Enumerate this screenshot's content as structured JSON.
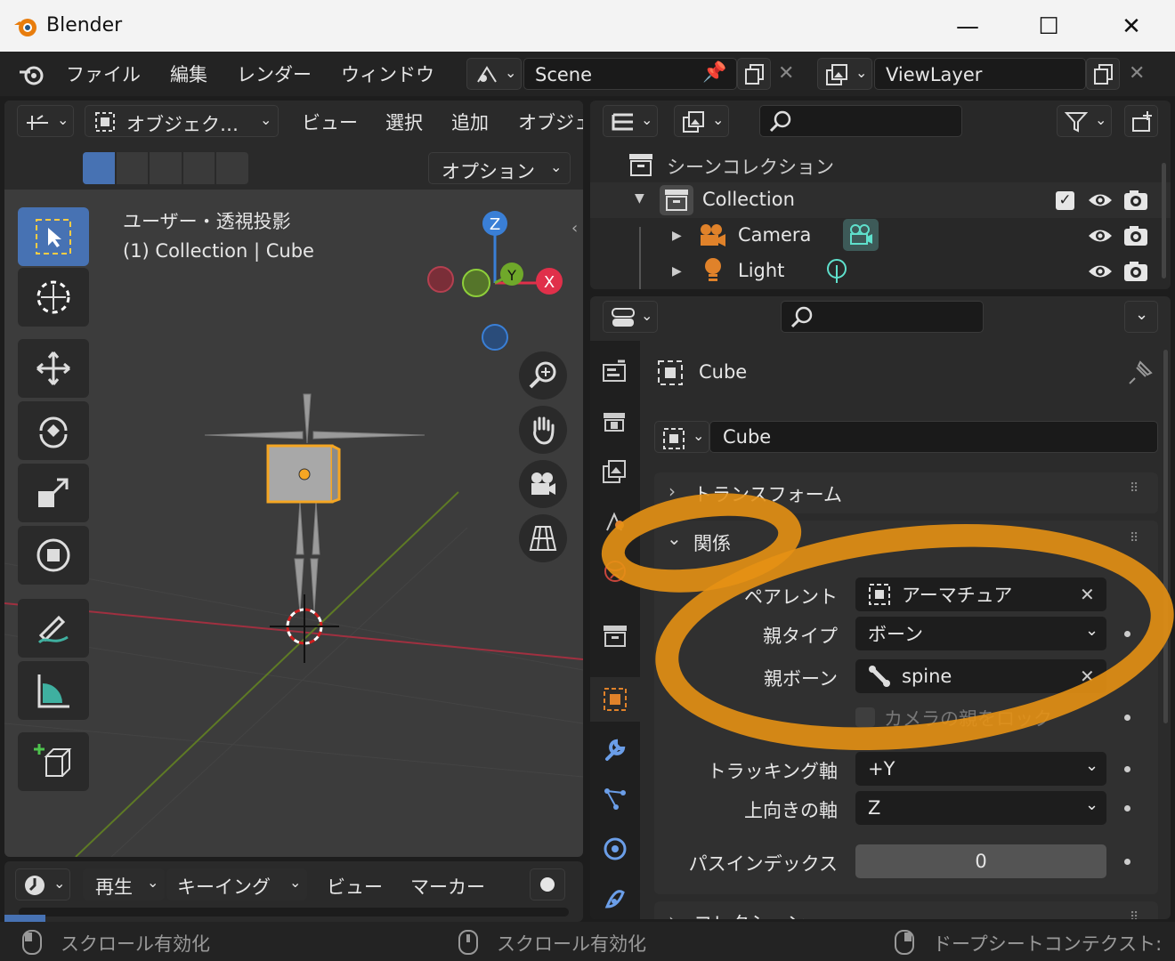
{
  "window": {
    "title": "Blender",
    "minimize": "—",
    "maximize": "☐",
    "close": "✕"
  },
  "menu": {
    "items": [
      "ファイル",
      "編集",
      "レンダー",
      "ウィンドウ"
    ],
    "scene": "Scene",
    "view_layer": "ViewLayer"
  },
  "viewport": {
    "mode_label": "オブジェク…",
    "header_menus": [
      "ビュー",
      "選択",
      "追加",
      "オブジェ"
    ],
    "options_label": "オプション",
    "view_name": "ユーザー・透視投影",
    "collection_info": "(1) Collection | Cube",
    "gizmo": {
      "z": "Z",
      "y": "Y",
      "x": "X"
    }
  },
  "timeline": {
    "menus": [
      "再生",
      "キーイング",
      "ビュー",
      "マーカー"
    ]
  },
  "outliner": {
    "scene_collection": "シーンコレクション",
    "rows": [
      {
        "name": "Collection"
      },
      {
        "name": "Camera"
      },
      {
        "name": "Light"
      }
    ]
  },
  "properties": {
    "object_name": "Cube",
    "object_field": "Cube",
    "sections": {
      "transform": "トランスフォーム",
      "relations": "関係",
      "collections": "コレクション"
    },
    "relations": {
      "parent_label": "ペアレント",
      "parent_value": "アーマチュア",
      "parent_type_label": "親タイプ",
      "parent_type_value": "ボーン",
      "parent_bone_label": "親ボーン",
      "parent_bone_value": "spine",
      "lock_camera_label": "カメラの親をロック",
      "tracking_axis_label": "トラッキング軸",
      "tracking_axis_value": "+Y",
      "up_axis_label": "上向きの軸",
      "up_axis_value": "Z",
      "pass_index_label": "パスインデックス",
      "pass_index_value": "0"
    }
  },
  "status": {
    "left": "スクロール有効化",
    "middle": "スクロール有効化",
    "right": "ドープシートコンテクスト:"
  },
  "colors": {
    "accent": "#4772b3",
    "selection": "#f5a623",
    "annotation": "#e69114"
  }
}
